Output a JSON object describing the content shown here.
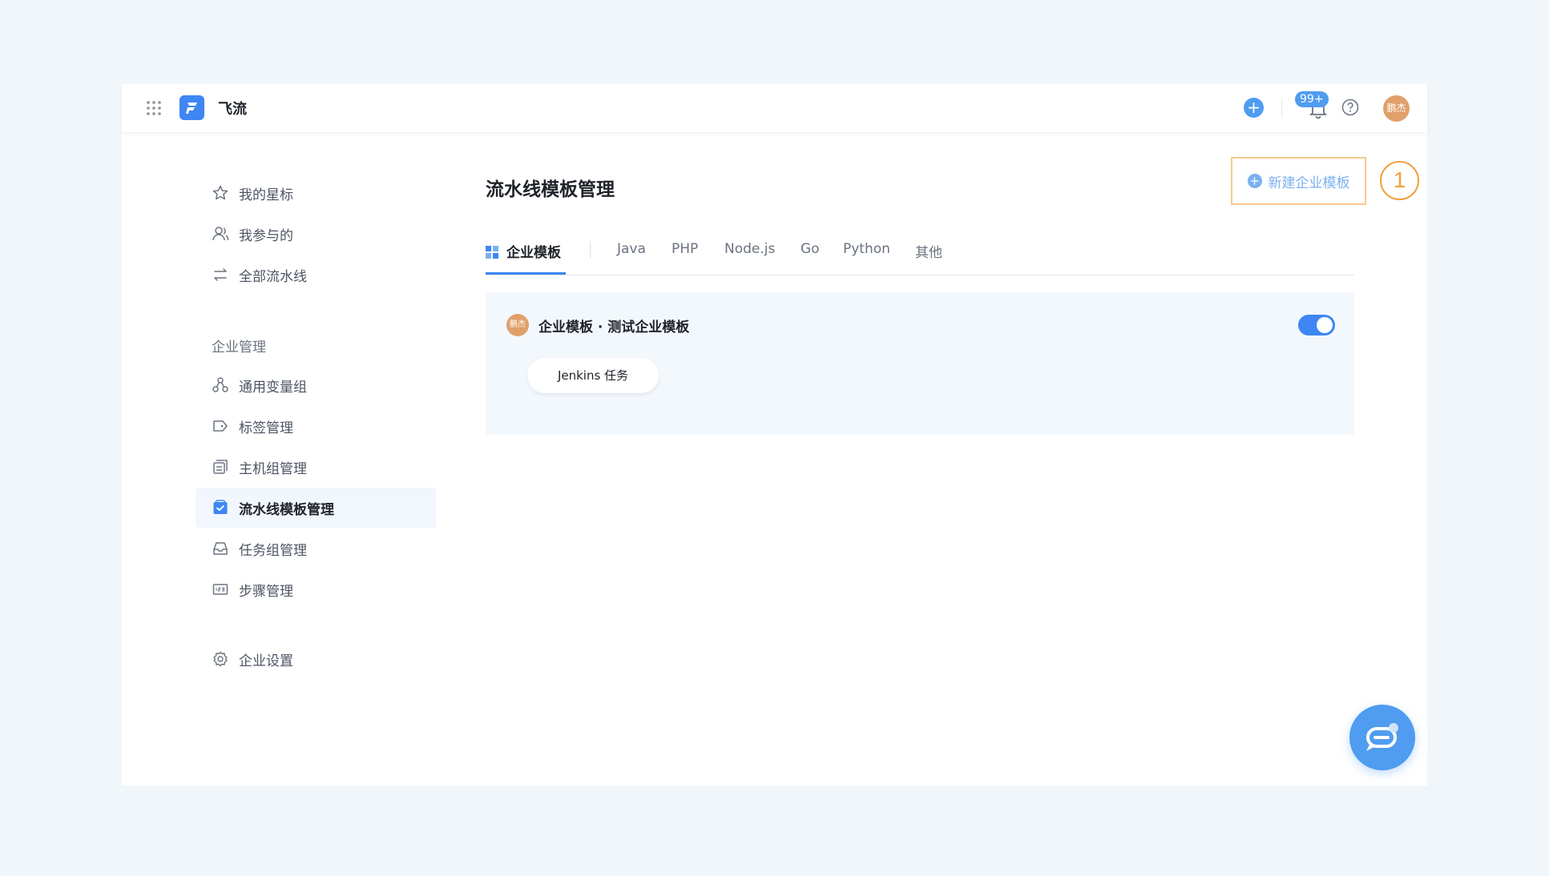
{
  "app": {
    "title": "飞流"
  },
  "topbar": {
    "notif_badge": "99+",
    "avatar_text": "鹏杰"
  },
  "sidebar": {
    "items_top": [
      {
        "label": "我的星标",
        "icon": "star-icon"
      },
      {
        "label": "我参与的",
        "icon": "user-icon"
      },
      {
        "label": "全部流水线",
        "icon": "swap-icon"
      }
    ],
    "section_label": "企业管理",
    "items_enterprise": [
      {
        "label": "通用变量组",
        "icon": "nodes-icon"
      },
      {
        "label": "标签管理",
        "icon": "tag-icon"
      },
      {
        "label": "主机组管理",
        "icon": "host-group-icon"
      },
      {
        "label": "流水线模板管理",
        "icon": "template-icon",
        "active": true
      },
      {
        "label": "任务组管理",
        "icon": "inbox-icon"
      },
      {
        "label": "步骤管理",
        "icon": "steps-icon"
      }
    ],
    "settings_label": "企业设置"
  },
  "main": {
    "title": "流水线模板管理",
    "new_button_label": "新建企业模板",
    "step_marker": "1",
    "tabs": [
      "企业模板",
      "Java",
      "PHP",
      "Node.js",
      "Go",
      "Python",
      "其他"
    ],
    "card": {
      "avatar_text": "鹏杰",
      "title": "企业模板 · 测试企业模板",
      "enabled": true,
      "task_label": "Jenkins 任务"
    }
  },
  "colors": {
    "accent": "#3d86f3",
    "highlight_border": "#f6c98f",
    "marker": "#f0a03b",
    "avatar": "#e0a06a"
  }
}
